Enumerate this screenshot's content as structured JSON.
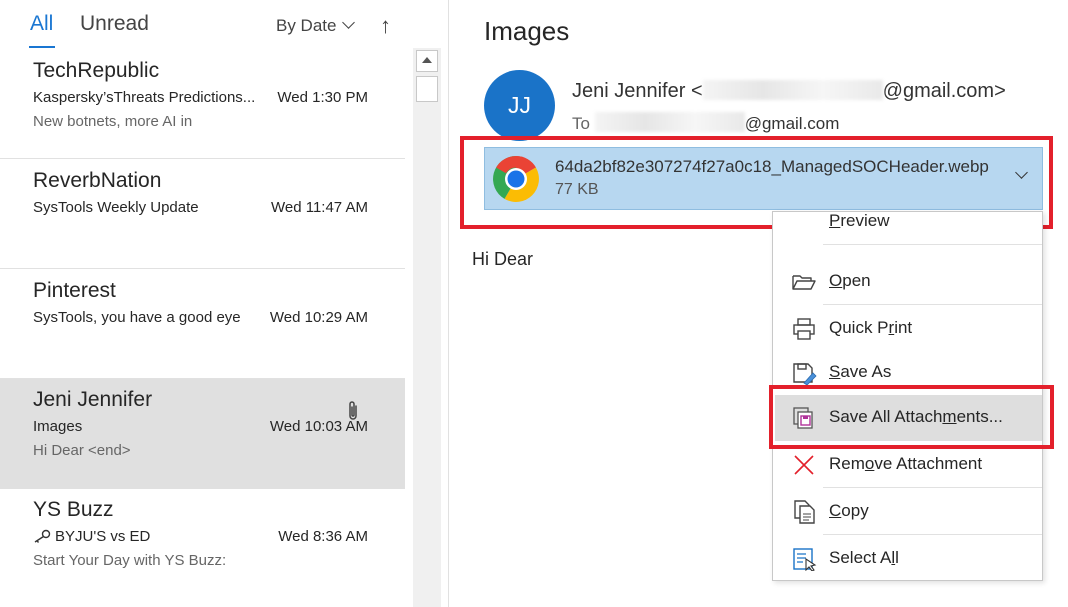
{
  "list": {
    "tabs": {
      "all": "All",
      "unread": "Unread"
    },
    "sort": {
      "label": "By Date"
    },
    "messages": [
      {
        "sender": "TechRepublic",
        "subject": "Kaspersky’sThreats Predictions...",
        "time": "Wed 1:30 PM",
        "preview": "New botnets, more AI in"
      },
      {
        "sender": "ReverbNation",
        "subject": "SysTools Weekly Update",
        "time": "Wed 11:47 AM",
        "preview": ""
      },
      {
        "sender": "Pinterest",
        "subject": "SysTools, you have a good eye",
        "time": "Wed 10:29 AM",
        "preview": ""
      },
      {
        "sender": "Jeni Jennifer",
        "subject": "Images",
        "time": "Wed 10:03 AM",
        "preview": "Hi Dear <end>"
      },
      {
        "sender": "YS Buzz",
        "subject": "BYJU'S vs ED",
        "time": "Wed 8:36 AM",
        "preview": "Start Your Day with YS Buzz:"
      }
    ]
  },
  "reading": {
    "subject": "Images",
    "avatar_initials": "JJ",
    "from_name": "Jeni Jennifer <",
    "from_email_tail": "@gmail.com>",
    "to_label": "To",
    "to_email_tail": "@gmail.com",
    "attachment": {
      "name": "64da2bf82e307274f27a0c18_ManagedSOCHeader.webp",
      "size": "77 KB"
    },
    "body": "Hi Dear"
  },
  "menu": {
    "preview": {
      "pre": "",
      "key": "P",
      "post": "review"
    },
    "open": {
      "pre": "",
      "key": "O",
      "post": "pen"
    },
    "quick_print": {
      "pre": "Quick P",
      "key": "r",
      "post": "int"
    },
    "save_as": {
      "pre": "",
      "key": "S",
      "post": "ave As"
    },
    "save_all": {
      "pre": "Save All Attach",
      "key": "m",
      "post": "ents..."
    },
    "remove": {
      "pre": "Rem",
      "key": "o",
      "post": "ve Attachment"
    },
    "copy": {
      "pre": "",
      "key": "C",
      "post": "opy"
    },
    "select_all": {
      "pre": "Select A",
      "key": "l",
      "post": "l"
    }
  },
  "colors": {
    "accent": "#1976d2",
    "avatar": "#1a73c8",
    "attachment_bg": "#b7d7f0",
    "highlight_red": "#e3202b",
    "selected_row": "#e0e0e0"
  }
}
